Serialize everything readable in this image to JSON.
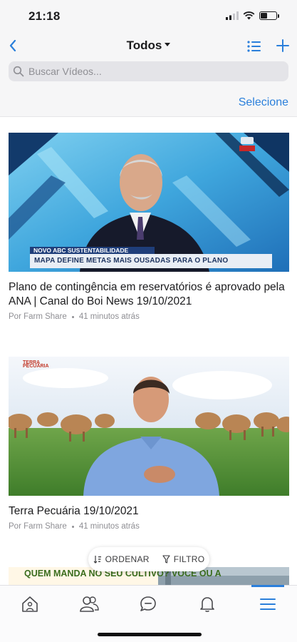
{
  "status_bar": {
    "time": "21:18"
  },
  "header": {
    "title": "Todos",
    "select_label": "Selecione",
    "accent_color": "#2a7fdb"
  },
  "search": {
    "placeholder": "Buscar Vídeos..."
  },
  "videos": [
    {
      "title": "Plano de contingência em reservatórios é aprovado pela ANA | Canal do Boi News 19/10/2021",
      "author": "Por Farm Share",
      "time_ago": "41 minutos atrás",
      "thumb_tag": "NOVO ABC SUSTENTABILIDADE",
      "thumb_caption": "MAPA DEFINE METAS MAIS OUSADAS PARA O PLANO"
    },
    {
      "title": "Terra Pecuária 19/10/2021",
      "author": "Por Farm Share",
      "time_ago": "41 minutos atrás",
      "thumb_logo": "TERRA PECUÁRIA"
    },
    {
      "thumb_text": "QUEM MANDA NO SEU CULTIVO? VOCÊ OU A"
    }
  ],
  "sort_bar": {
    "sort_label": "ORDENAR",
    "filter_label": "FILTRO"
  },
  "tabs": [
    {
      "icon": "home-icon"
    },
    {
      "icon": "people-icon"
    },
    {
      "icon": "chat-icon"
    },
    {
      "icon": "bell-icon"
    },
    {
      "icon": "menu-icon",
      "active": true
    }
  ]
}
